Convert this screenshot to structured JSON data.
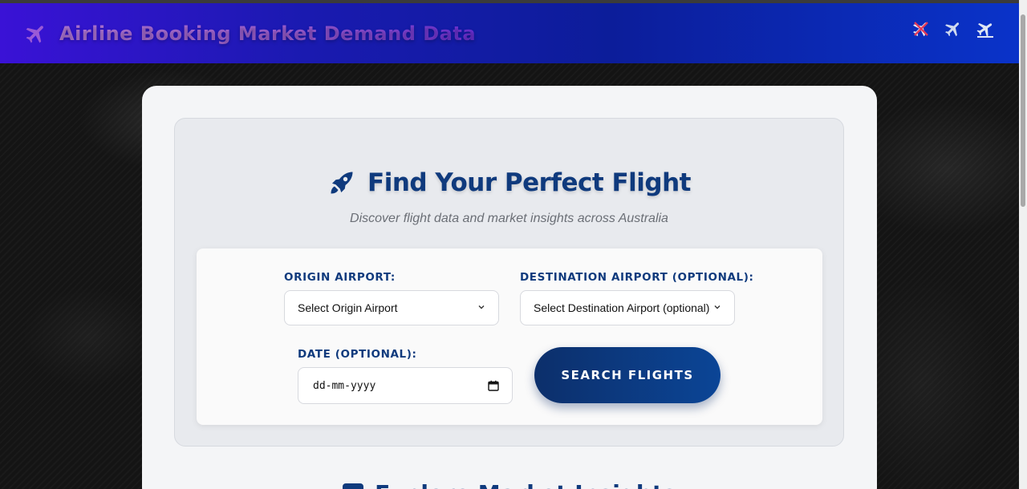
{
  "header": {
    "title": "Airline Booking Market Demand Data",
    "brand_icon": "airplane-icon",
    "right_icons": [
      "airplane-cancel-icon",
      "airplane-icon",
      "airplane-landing-icon"
    ],
    "gradient_start": "#3a12d6",
    "gradient_end": "#0a33c9"
  },
  "search": {
    "title": "Find Your Perfect Flight",
    "icon": "rocket-icon",
    "subtitle": "Discover flight data and market insights across Australia",
    "origin_label": "ORIGIN AIRPORT:",
    "origin_value": "Select Origin Airport",
    "destination_label": "DESTINATION AIRPORT (OPTIONAL):",
    "destination_value": "Select Destination Airport (optional)",
    "date_label": "DATE (OPTIONAL):",
    "date_placeholder": "dd-mm-yyyy",
    "button_label": "SEARCH FLIGHTS"
  },
  "explore": {
    "title": "Explore Market Insights"
  },
  "colors": {
    "accent": "#0f3a7d",
    "button": "#0c2f6b"
  }
}
